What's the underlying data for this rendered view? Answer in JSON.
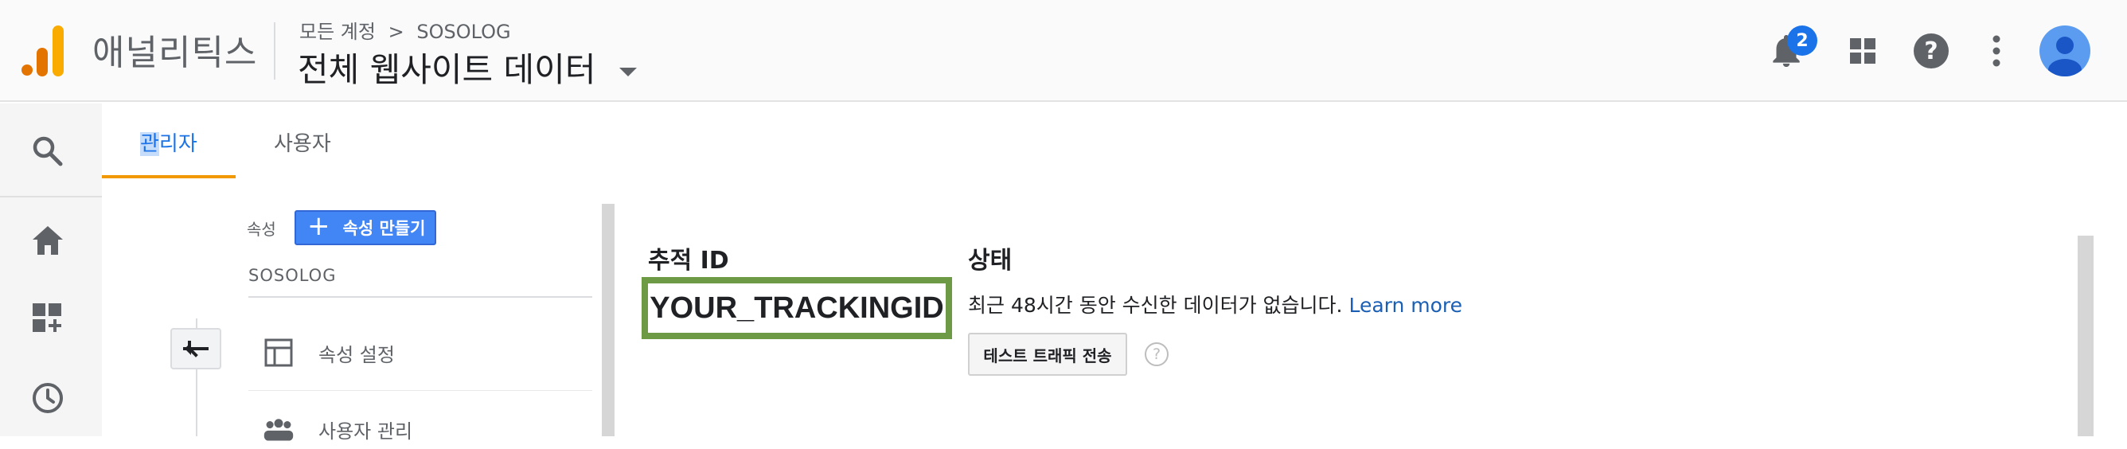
{
  "header": {
    "brand": "애널리틱스",
    "breadcrumb": {
      "root": "모든 계정",
      "separator": ">",
      "account": "SOSOLOG"
    },
    "view_title": "전체 웹사이트 데이터",
    "notification_count": "2",
    "icons": [
      "analytics-logo-icon",
      "bell-icon",
      "apps-grid-icon",
      "help-icon",
      "more-vert-icon",
      "avatar-icon"
    ]
  },
  "left_nav": {
    "icons": [
      "search-icon",
      "home-icon",
      "customization-icon",
      "clock-icon"
    ]
  },
  "tabs": [
    {
      "label_highlight": "관",
      "label_rest": "리자",
      "selected": true
    },
    {
      "label": "사용자",
      "selected": false
    }
  ],
  "property_column": {
    "label": "속성",
    "create_button": "속성 만들기",
    "property_name": "SOSOLOG",
    "items": [
      {
        "label": "속성 설정",
        "icon": "layout-icon"
      },
      {
        "label": "사용자 관리",
        "icon": "people-icon"
      }
    ]
  },
  "tracking": {
    "id_header": "추적 ID",
    "id_value": "YOUR_TRACKINGID",
    "status_header": "상태",
    "status_text": "최근 48시간 동안 수신한 데이터가 없습니다.",
    "learn_more": "Learn more",
    "test_button": "테스트 트래픽 전송",
    "help_glyph": "?"
  },
  "colors": {
    "accent_blue": "#1a73e8",
    "tab_underline": "#f29900",
    "highlight_box": "#6d9a45",
    "create_button": "#4285f4"
  }
}
